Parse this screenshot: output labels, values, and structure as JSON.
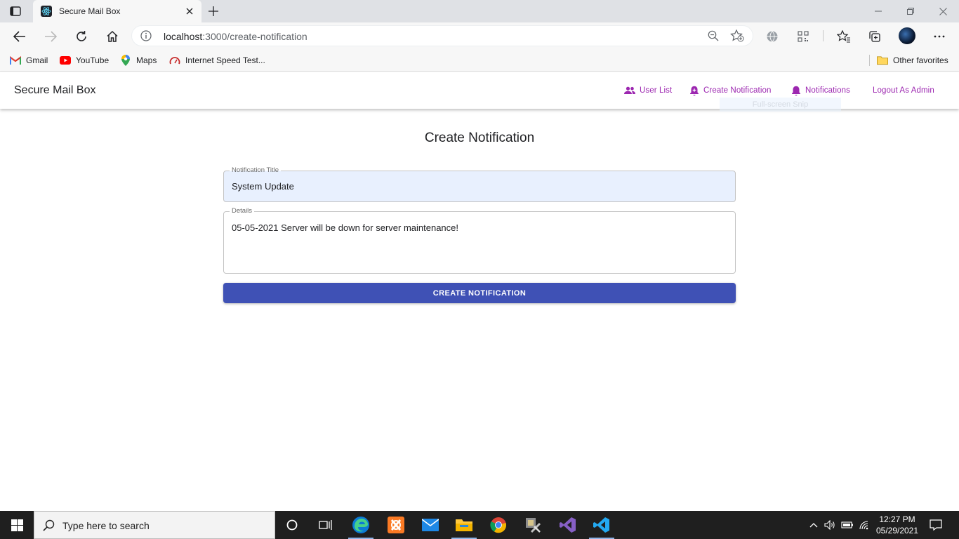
{
  "browser": {
    "tab_title": "Secure Mail Box",
    "url_host": "localhost",
    "url_rest": ":3000/create-notification",
    "favorites": [
      {
        "label": "Gmail",
        "icon": "gmail-icon"
      },
      {
        "label": "YouTube",
        "icon": "youtube-icon"
      },
      {
        "label": "Maps",
        "icon": "maps-icon"
      },
      {
        "label": "Internet Speed Test...",
        "icon": "speedtest-icon"
      }
    ],
    "other_favorites": "Other favorites"
  },
  "app": {
    "brand": "Secure Mail Box",
    "nav": [
      {
        "label": "User List",
        "icon": "people-icon"
      },
      {
        "label": "Create Notification",
        "icon": "bell-plus-icon"
      },
      {
        "label": "Notifications",
        "icon": "bell-icon"
      },
      {
        "label": "Logout As Admin"
      }
    ],
    "accent_color": "#9c27b0",
    "snip_tooltip": "Full-screen Snip"
  },
  "form": {
    "heading": "Create Notification",
    "title_label": "Notification Title",
    "title_value": "System Update",
    "details_label": "Details",
    "details_value": "05-05-2021 Server will be down for server maintenance!",
    "submit_label": "CREATE NOTIFICATION",
    "button_color": "#3f51b5"
  },
  "taskbar": {
    "search_placeholder": "Type here to search",
    "time": "12:27 PM",
    "date": "05/29/2021"
  }
}
